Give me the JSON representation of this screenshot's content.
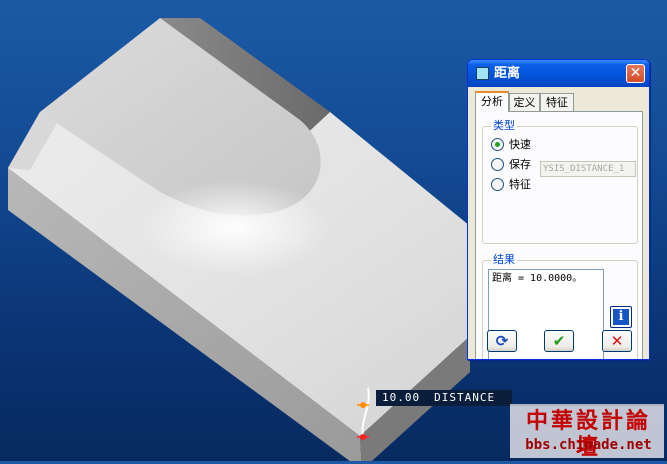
{
  "dialog": {
    "title": "距离",
    "close_symbol": "✕",
    "tabs": [
      {
        "label": "分析",
        "active": true
      },
      {
        "label": "定义",
        "active": false
      },
      {
        "label": "特征",
        "active": false
      }
    ],
    "type_group": {
      "label": "类型",
      "options": [
        {
          "label": "快速",
          "selected": true
        },
        {
          "label": "保存",
          "selected": false
        },
        {
          "label": "特征",
          "selected": false
        }
      ],
      "name_value": "YSIS_DISTANCE_1"
    },
    "result_group": {
      "label": "结果",
      "text": "距离 = 10.0000。"
    },
    "buttons": {
      "repeat": "⟳",
      "ok": "✔",
      "cancel": "✕"
    },
    "icons": {
      "title": "window-icon",
      "info": "info-icon"
    }
  },
  "viewport": {
    "dimension_value": "10.00",
    "dimension_label": "DISTANCE"
  },
  "watermark": {
    "title": "中華設計論壇",
    "url": "bbs.chinade.net"
  },
  "colors": {
    "background_top": "#1c5aa6",
    "background_bottom": "#072a60",
    "title_bar": "#0453d8",
    "tab_active_accent": "#e68b2c",
    "group_label": "#0046d5",
    "ok_green": "#1c9a1c",
    "cancel_red": "#d01010",
    "watermark_red": "#c40000"
  }
}
